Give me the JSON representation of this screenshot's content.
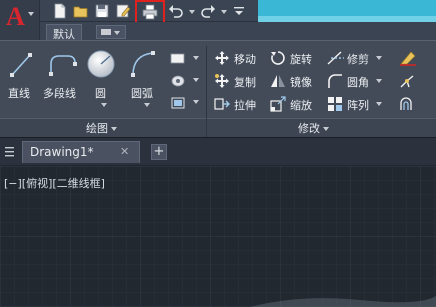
{
  "app": {
    "logo_letter": "A"
  },
  "ribbon_tabs": [
    {
      "label": "默认"
    }
  ],
  "draw_panel": {
    "tools": {
      "line": "直线",
      "polyline": "多段线",
      "circle": "圆",
      "arc": "圆弧"
    },
    "footer": "绘图"
  },
  "modify_panel": {
    "tools": {
      "move": "移动",
      "rotate": "旋转",
      "trim": "修剪",
      "copy": "复制",
      "mirror": "镜像",
      "fillet": "圆角",
      "stretch": "拉伸",
      "scale": "缩放",
      "array": "阵列"
    },
    "footer": "修改"
  },
  "document": {
    "tab_label": "Drawing1*",
    "close_glyph": "✕",
    "new_tab_glyph": "+"
  },
  "viewport": {
    "label": "[−][俯视][二维线框]"
  },
  "colors": {
    "accent_red": "#e0221f",
    "logo_red": "#d9252d",
    "title_cyan": "#3bb7d6"
  }
}
